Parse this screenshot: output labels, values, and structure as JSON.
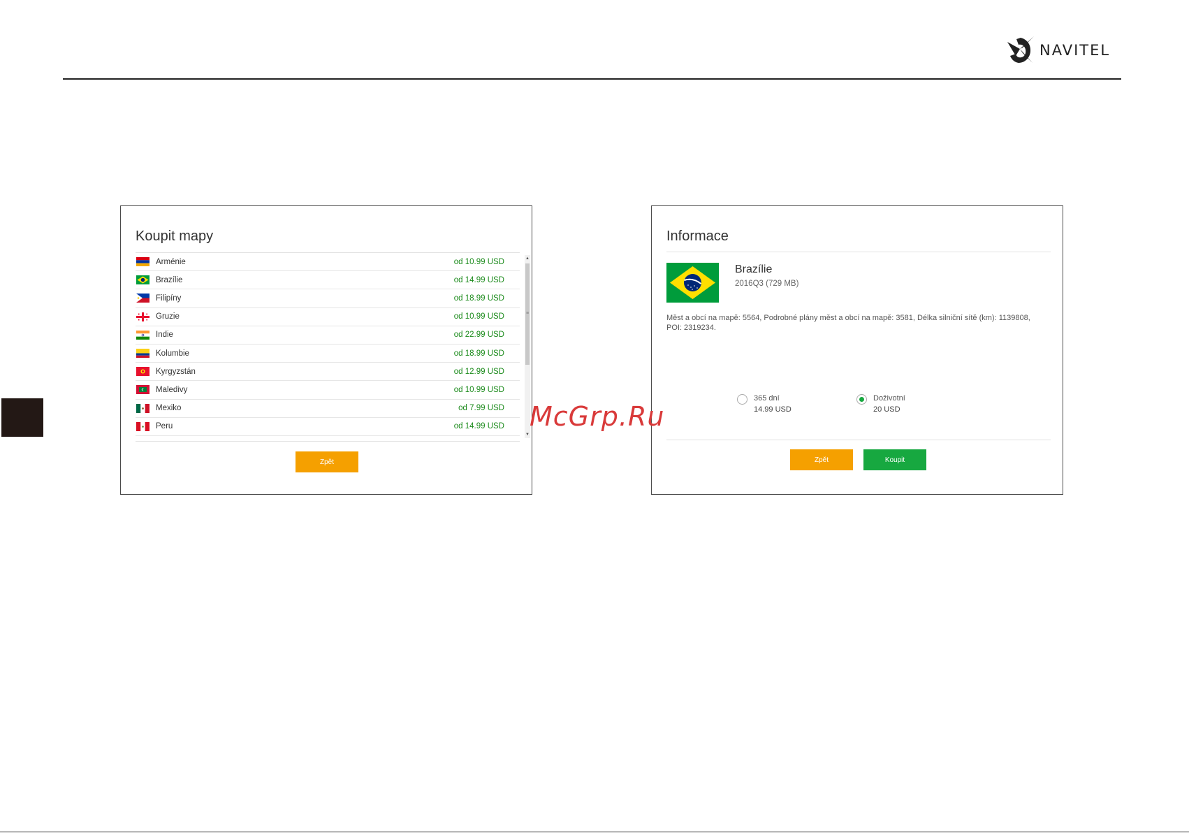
{
  "brand": {
    "name": "NAVITEL"
  },
  "watermark": "McGrp.Ru",
  "buy_maps": {
    "title": "Koupit mapy",
    "items": [
      {
        "country": "Arménie",
        "price": "od 10.99 USD",
        "flag": "armenia-flag"
      },
      {
        "country": "Brazílie",
        "price": "od 14.99 USD",
        "flag": "brazil-flag"
      },
      {
        "country": "Filipíny",
        "price": "od 18.99 USD",
        "flag": "philippines-flag"
      },
      {
        "country": "Gruzie",
        "price": "od 10.99 USD",
        "flag": "georgia-flag"
      },
      {
        "country": "Indie",
        "price": "od 22.99 USD",
        "flag": "india-flag"
      },
      {
        "country": "Kolumbie",
        "price": "od 18.99 USD",
        "flag": "colombia-flag"
      },
      {
        "country": "Kyrgyzstán",
        "price": "od 12.99 USD",
        "flag": "kyrgyzstan-flag"
      },
      {
        "country": "Maledivy",
        "price": "od 10.99 USD",
        "flag": "maldives-flag"
      },
      {
        "country": "Mexiko",
        "price": "od 7.99 USD",
        "flag": "mexico-flag"
      },
      {
        "country": "Peru",
        "price": "od 14.99 USD",
        "flag": "peru-flag"
      }
    ],
    "back_label": "Zpět"
  },
  "info": {
    "title": "Informace",
    "country_name": "Brazílie",
    "version": "2016Q3 (729 MB)",
    "description": "Měst a obcí na mapě: 5564, Podrobné plány měst a obcí na mapě: 3581, Délka silniční sítě (km): 1139808, POI: 2319234.",
    "options": [
      {
        "label": "365 dní",
        "price": "14.99 USD",
        "selected": false
      },
      {
        "label": "Doživotní",
        "price": "20 USD",
        "selected": true
      }
    ],
    "back_label": "Zpět",
    "buy_label": "Koupit"
  },
  "colors": {
    "price_green": "#1a8a1a",
    "button_orange": "#f5a000",
    "button_green": "#17a840"
  }
}
